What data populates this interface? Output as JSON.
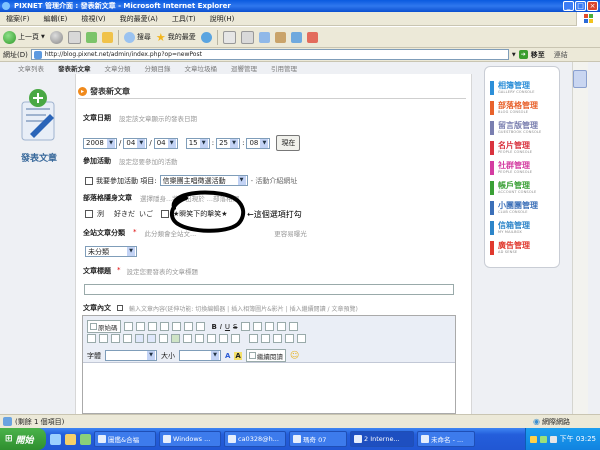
{
  "window": {
    "title": "PIXNET 管理介面 : 發表新文章 - Microsoft Internet Explorer",
    "buttons": [
      "_",
      "□",
      "×"
    ]
  },
  "menu": [
    "檔案(F)",
    "編輯(E)",
    "檢視(V)",
    "我的最愛(A)",
    "工具(T)",
    "說明(H)"
  ],
  "toolbar": {
    "back": "上一頁",
    "search": "搜尋",
    "favorites": "我的最愛"
  },
  "address": {
    "label": "網址(D)",
    "url": "http://blog.pixnet.net/admin/index.php?op=newPost",
    "go": "移至",
    "links": "連結"
  },
  "nav_tabs": [
    "文章列表",
    "發表新文章",
    "文章分類",
    "分類目錄",
    "文章垃圾桶",
    "迴響管理",
    "引用管理"
  ],
  "sidebar": {
    "label": "發表文章"
  },
  "section_title": "發表新文章",
  "form": {
    "date_label": "文章日期",
    "date_hint": "設定該文章顯示的發表日期",
    "year": "2008",
    "month": "04",
    "day": "04",
    "hour": "15",
    "minute": "25",
    "second": "08",
    "now_button": "現在",
    "event_label": "參加活動",
    "event_hint": "設定您要參加的活動",
    "event_checkbox": "我要參加活動 項目:",
    "event_select": "信樂團主唱徵選活動",
    "event_link": "- 活動介紹網址",
    "hidden_label": "部落格隱身文章",
    "hidden_hint": "選擇隱身...將不出現於 ...部落格網",
    "hidden_opt1": "洌",
    "hidden_opt2": "好きだ",
    "hidden_opt3": "いご",
    "hidden_opt4": "★瞬笑下的擊笑★",
    "annotation": "←這個選項打勾",
    "site_cat_label": "全站文章分類",
    "site_cat_hint": "此分類會全站文...",
    "site_cat_hint2": "更容易曝光",
    "site_cat_select": "未分類",
    "title_label": "文章標題",
    "title_hint": "設定您要發表的文章標題",
    "title_value": "",
    "content_label": "文章內文",
    "content_hint": "輸入文章內容(延伸功能: 切換編輯器 | 插入相簿圖片&影片 | 插入繼續閱讀 / 文章預覽)"
  },
  "editor": {
    "source_button": "原始碼",
    "font_label": "字體",
    "size_label": "大小",
    "more_button": "繼續閱讀"
  },
  "right_menu": [
    {
      "title": "相簿管理",
      "sub": "GALLERY CONSOLE",
      "color": "#2d8fd8"
    },
    {
      "title": "部落格管理",
      "sub": "BLOG CONSOLE",
      "color": "#e8622c"
    },
    {
      "title": "留言版管理",
      "sub": "GUESTBOOK CONSOLE",
      "color": "#7a7fb0"
    },
    {
      "title": "名片管理",
      "sub": "PEOPLE CONSOLE",
      "color": "#d9333f"
    },
    {
      "title": "社群管理",
      "sub": "PEOPLE CONSOLE",
      "color": "#d43ca1"
    },
    {
      "title": "帳戶管理",
      "sub": "ACCOUNT CONSOLE",
      "color": "#3aa036"
    },
    {
      "title": "小團團管理",
      "sub": "CLUB CONSOLE",
      "color": "#3b6fb8"
    },
    {
      "title": "信箱管理",
      "sub": "MY MAILBOX",
      "color": "#2d85c9"
    },
    {
      "title": "廣告管理",
      "sub": "AD SENSE",
      "color": "#e0392e"
    }
  ],
  "status": {
    "text": "(剩餘 1 個項目)",
    "zone": "網際網路"
  },
  "taskbar": {
    "start": "開始",
    "tasks": [
      "圖鑑&合福",
      "Windows ...",
      "ca0328@h...",
      "瑪奇 07",
      "2 Interne...",
      "未命名 - ..."
    ],
    "time": "下午 03:25"
  }
}
